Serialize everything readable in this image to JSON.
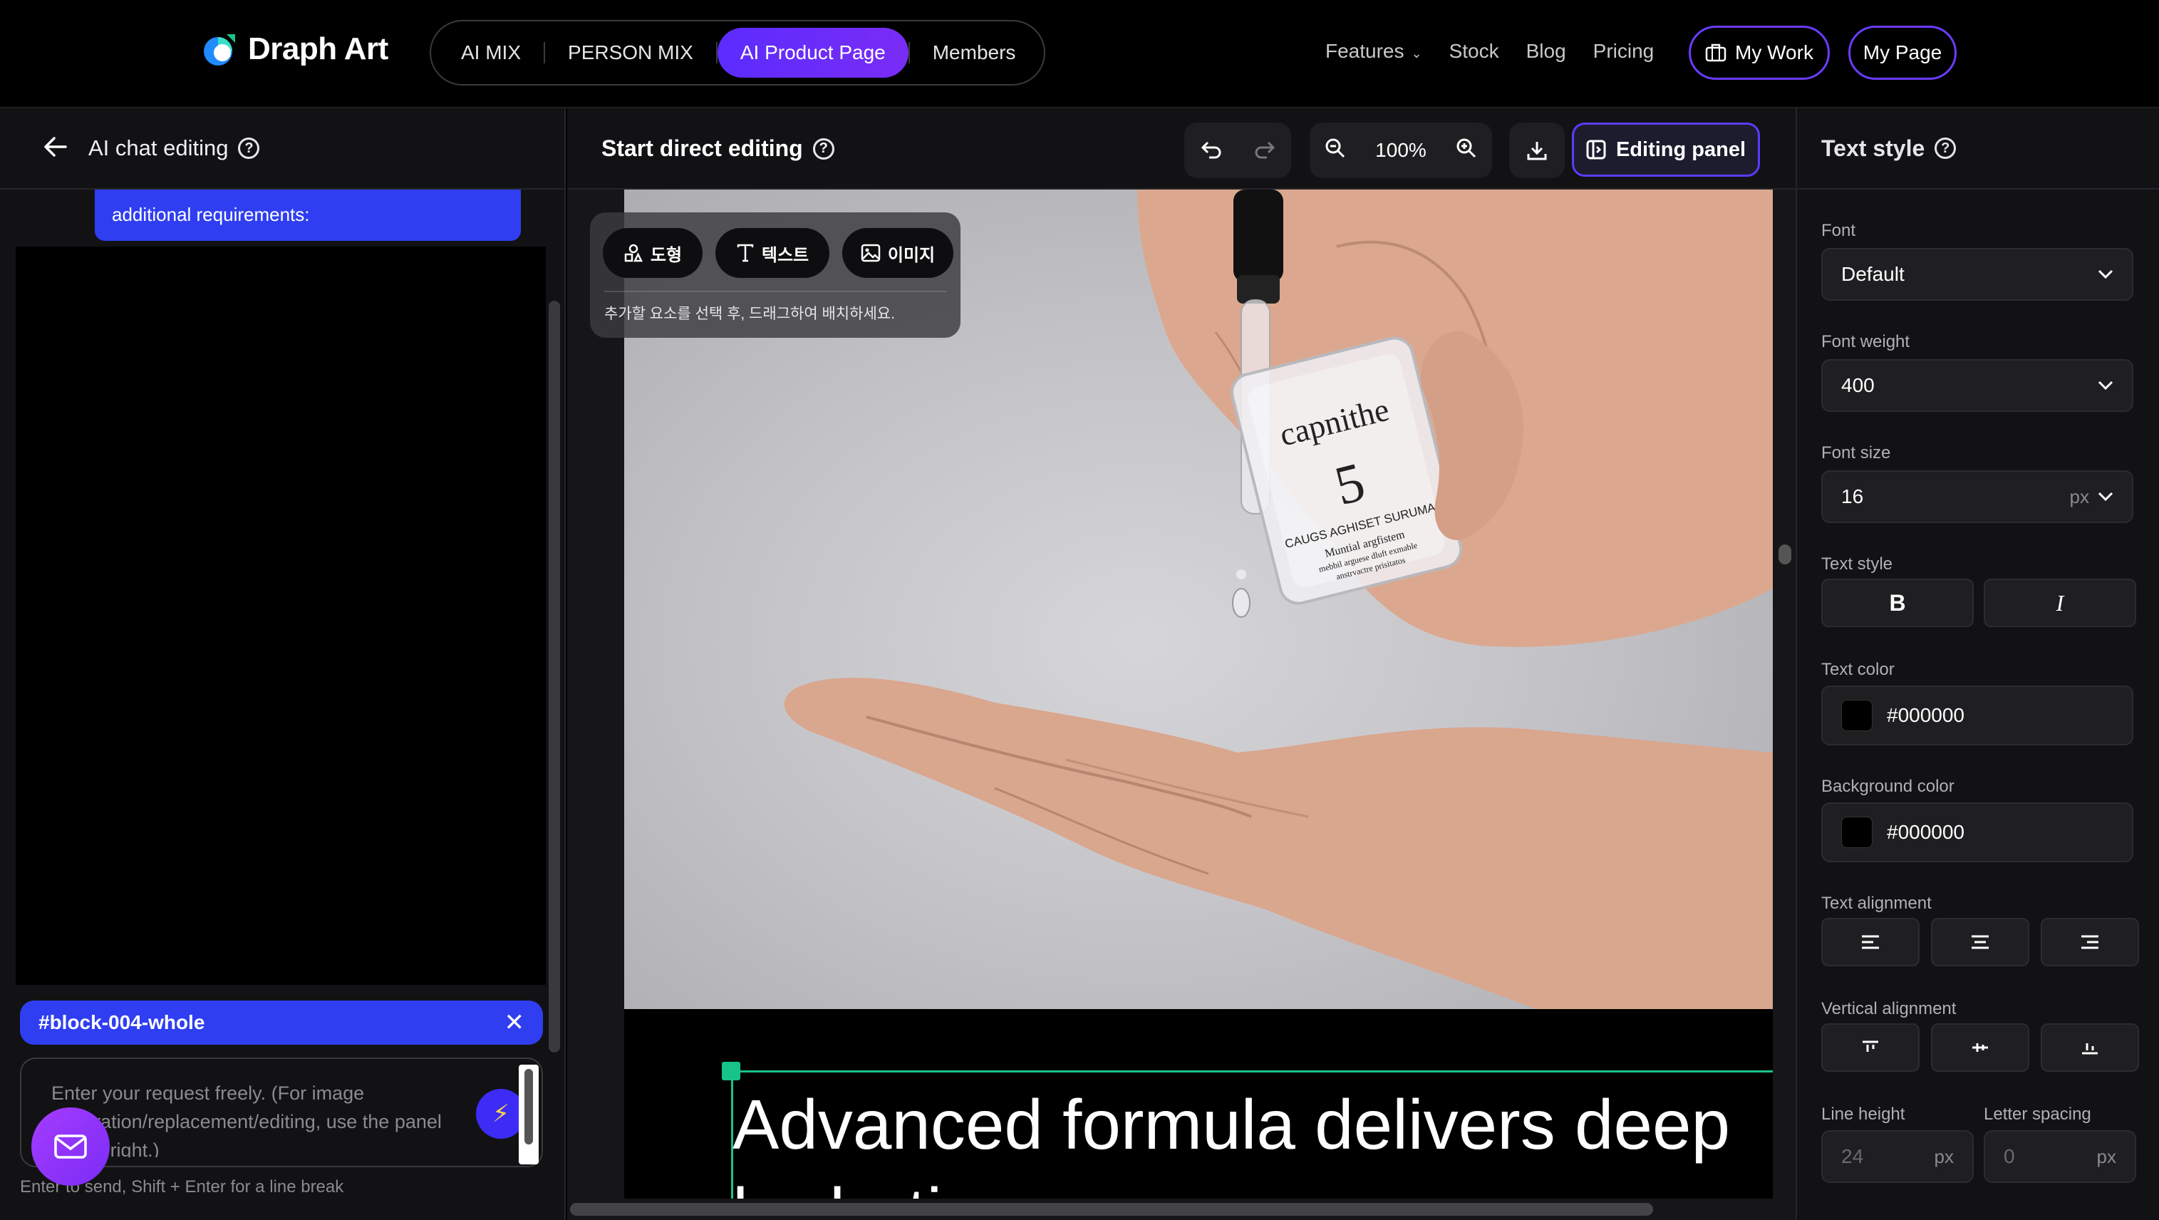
{
  "nav": {
    "brand": "Draph Art",
    "tabs": [
      {
        "label": "AI MIX"
      },
      {
        "label": "PERSON MIX"
      },
      {
        "label": "AI Product Page"
      },
      {
        "label": "Members"
      }
    ],
    "links": [
      "Features",
      "Stock",
      "Blog",
      "Pricing"
    ],
    "my_work": "My Work",
    "my_page": "My Page"
  },
  "left": {
    "title": "AI chat editing",
    "bubble_text": "additional requirements:",
    "block_tag": "#block-004-whole",
    "input_placeholder": "Enter your request freely. (For image generation/replacement/editing, use the panel on the right.)",
    "hint": "Enter to send, Shift + Enter for a line break"
  },
  "center": {
    "title": "Start direct editing",
    "zoom": "100%",
    "editing_panel": "Editing panel",
    "toolbar": {
      "shape": "도형",
      "text": "텍스트",
      "image": "이미지",
      "hint": "추가할 요소를 선택 후, 드래그하여 배치하세요."
    },
    "product": {
      "brand": "capnithe",
      "number": "5",
      "line1": "CAUGS AGHISET SURUMA",
      "line2": "Muntial argfistem",
      "line3": "mebbil arguese dluft exmable",
      "line4": "anstrvactre prisitatos"
    },
    "headline": "Advanced formula delivers deep hydration"
  },
  "right": {
    "title": "Text style",
    "font_label": "Font",
    "font_value": "Default",
    "weight_label": "Font weight",
    "weight_value": "400",
    "size_label": "Font size",
    "size_value": "16",
    "size_unit": "px",
    "text_style_label": "Text style",
    "bold": "B",
    "italic": "I",
    "text_color_label": "Text color",
    "text_color": "#000000",
    "bg_color_label": "Background color",
    "bg_color": "#000000",
    "align_label": "Text alignment",
    "valign_label": "Vertical alignment",
    "line_height_label": "Line height",
    "line_height_value": "24",
    "letter_spacing_label": "Letter spacing",
    "letter_spacing_value": "0",
    "unit": "px"
  },
  "colors": {
    "accent": "#6b2bff",
    "chat_blue": "#2f3ef0",
    "selection": "#18c38a"
  }
}
